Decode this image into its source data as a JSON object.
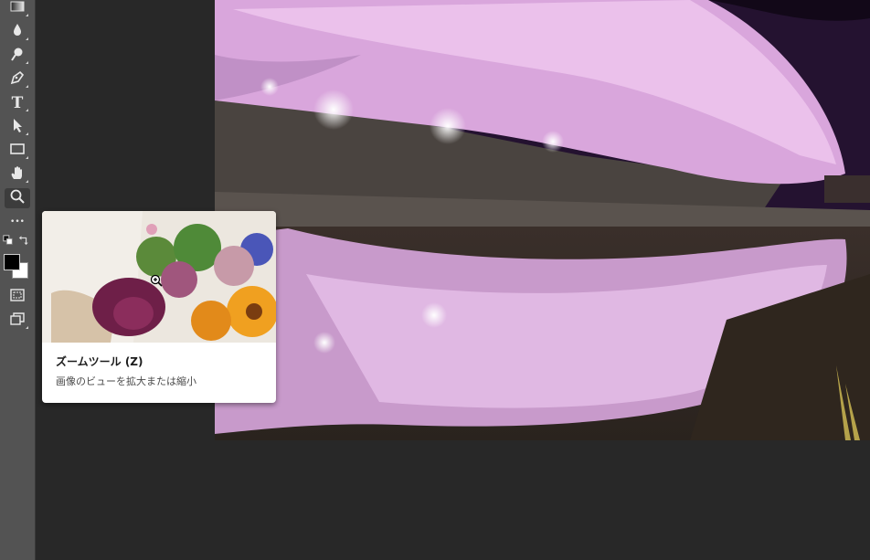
{
  "toolbar": {
    "tools": [
      {
        "name": "gradient-tool-icon",
        "selected": false
      },
      {
        "name": "blur-tool-icon",
        "selected": false
      },
      {
        "name": "dodge-tool-icon",
        "selected": false
      },
      {
        "name": "pen-tool-icon",
        "selected": false
      },
      {
        "name": "type-tool-icon",
        "label": "T",
        "selected": false
      },
      {
        "name": "path-selection-tool-icon",
        "selected": false
      },
      {
        "name": "rectangle-tool-icon",
        "selected": false
      },
      {
        "name": "hand-tool-icon",
        "selected": false
      },
      {
        "name": "zoom-tool-icon",
        "selected": true
      },
      {
        "name": "more-tools-icon",
        "label": "•••",
        "selected": false
      }
    ],
    "foreground_color": "#000000",
    "background_color": "#ffffff"
  },
  "tooltip": {
    "title": "ズームツール (Z)",
    "description": "画像のビューを拡大または縮小"
  },
  "colors": {
    "workspace": "#282828",
    "toolbar": "#535353",
    "accent_selected": "#3c3c3c"
  }
}
